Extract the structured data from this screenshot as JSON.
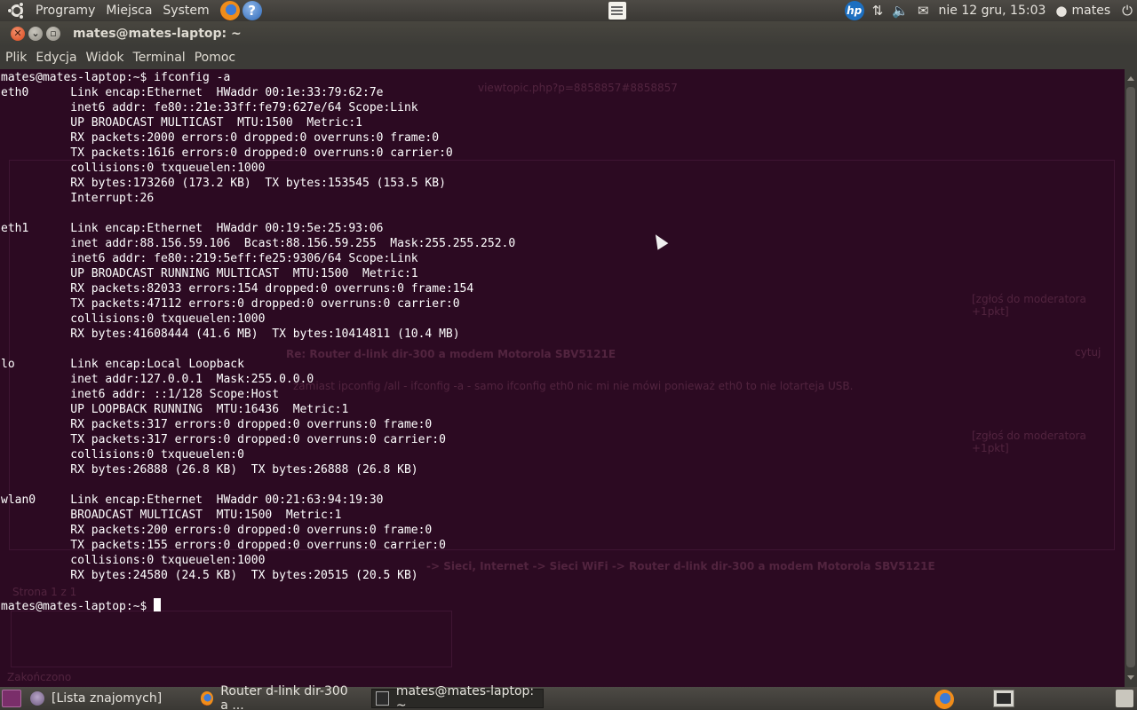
{
  "top_panel": {
    "menus": [
      "Programy",
      "Miejsca",
      "System"
    ],
    "clock": "nie 12 gru, 15:03",
    "user": "mates",
    "hp_label": "hp",
    "help_label": "?"
  },
  "window": {
    "title": "mates@mates-laptop: ~",
    "close_glyph": "✕",
    "min_glyph": "⌄",
    "max_glyph": "▫"
  },
  "menubar": [
    "Plik",
    "Edycja",
    "Widok",
    "Terminal",
    "Pomoc"
  ],
  "terminal": {
    "lines": [
      "mates@mates-laptop:~$ ifconfig -a",
      "eth0      Link encap:Ethernet  HWaddr 00:1e:33:79:62:7e",
      "          inet6 addr: fe80::21e:33ff:fe79:627e/64 Scope:Link",
      "          UP BROADCAST MULTICAST  MTU:1500  Metric:1",
      "          RX packets:2000 errors:0 dropped:0 overruns:0 frame:0",
      "          TX packets:1616 errors:0 dropped:0 overruns:0 carrier:0",
      "          collisions:0 txqueuelen:1000",
      "          RX bytes:173260 (173.2 KB)  TX bytes:153545 (153.5 KB)",
      "          Interrupt:26",
      "",
      "eth1      Link encap:Ethernet  HWaddr 00:19:5e:25:93:06",
      "          inet addr:88.156.59.106  Bcast:88.156.59.255  Mask:255.255.252.0",
      "          inet6 addr: fe80::219:5eff:fe25:9306/64 Scope:Link",
      "          UP BROADCAST RUNNING MULTICAST  MTU:1500  Metric:1",
      "          RX packets:82033 errors:154 dropped:0 overruns:0 frame:154",
      "          TX packets:47112 errors:0 dropped:0 overruns:0 carrier:0",
      "          collisions:0 txqueuelen:1000",
      "          RX bytes:41608444 (41.6 MB)  TX bytes:10414811 (10.4 MB)",
      "",
      "lo        Link encap:Local Loopback",
      "          inet addr:127.0.0.1  Mask:255.0.0.0",
      "          inet6 addr: ::1/128 Scope:Host",
      "          UP LOOPBACK RUNNING  MTU:16436  Metric:1",
      "          RX packets:317 errors:0 dropped:0 overruns:0 frame:0",
      "          TX packets:317 errors:0 dropped:0 overruns:0 carrier:0",
      "          collisions:0 txqueuelen:0",
      "          RX bytes:26888 (26.8 KB)  TX bytes:26888 (26.8 KB)",
      "",
      "wlan0     Link encap:Ethernet  HWaddr 00:21:63:94:19:30",
      "          BROADCAST MULTICAST  MTU:1500  Metric:1",
      "          RX packets:200 errors:0 dropped:0 overruns:0 frame:0",
      "          TX packets:155 errors:0 dropped:0 overruns:0 carrier:0",
      "          collisions:0 txqueuelen:1000",
      "          RX bytes:24580 (24.5 KB)  TX bytes:20515 (20.5 KB)",
      ""
    ],
    "prompt": "mates@mates-laptop:~$ "
  },
  "background_ghost": {
    "url_fragment": "viewtopic.php?p=8858857#8858857",
    "link1": "[zgłoś do moderatora +1pkt]",
    "post_title": "Re: Router d-link dir-300 a modem Motorola SBV5121E",
    "post_text": "zamiast ipconfig /all - ifconfig -a - samo ifconfig eth0 nic mi nie mówi ponieważ eth0 to nie lotarteja USB.",
    "breadcrumb": "-> Sieci, Internet -> Sieci WiFi -> Router d-link dir-300 a modem Motorola SBV5121E",
    "page": "Strona 1 z 1",
    "status": "Zakończono",
    "quote": "cytuj"
  },
  "taskbar": {
    "tasks": [
      {
        "label": "[Lista znajomych]",
        "icon": "pidgin-icon"
      },
      {
        "label": "Router d-link dir-300 a ...",
        "icon": "firefox-icon"
      },
      {
        "label": "mates@mates-laptop: ~",
        "icon": "terminal-icon"
      }
    ]
  }
}
